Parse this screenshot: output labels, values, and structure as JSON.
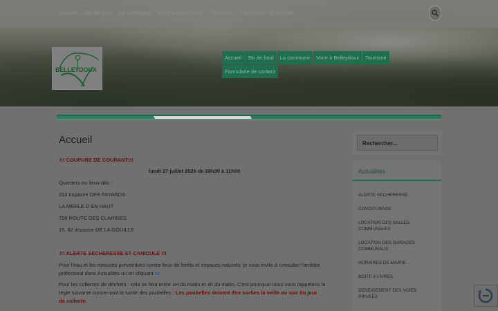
{
  "topbar": {
    "items": [
      "Accueil",
      "Ski de fond",
      "La commune",
      "Vivre à Belleydoux",
      "Tourisme",
      "Formulaire de contact"
    ]
  },
  "logo": {
    "text": "BELLEYDOUX"
  },
  "mainnav": {
    "row1": [
      "Accueil",
      "Ski de fond",
      "La commune",
      "Vivre à Belleydoux",
      "Tourisme"
    ],
    "row2": [
      "Formulaire de contact"
    ]
  },
  "content": {
    "title": "Accueil",
    "alert1": "!!! COUPURE DE COURANT!!!",
    "date_line": "lundi 27 juillet 2026 de 08h30 à 11h00",
    "quartiers": "Quartiers ou lieux-dits :",
    "addresses": [
      "316 impasse DES FAYARDS",
      "LA MERLE D EN HAUT",
      "798 ROUTE DES CLARINES",
      "15, 82 impasse DE LA GOUILLE"
    ],
    "alert2": "!!! ALERTE SECHERESSE ET CANICULE !!!",
    "para1_a": "Pour l'eau et les mesures préventives contre feux de forêts et espaces naturels: je vous invite à consulter l'arrêtée",
    "para1_b": "préfectoral dans Actualités ou en cliquant",
    "para1_link": "ici",
    "para1_end": ".",
    "para2_a": "Pour les collectes de déchets : cela se fera entre 1H du matin et 4h du matin. C'est pourquoi nous vous rappelons la",
    "para2_b": "règle suivante concernant la sortie des poubelles : ",
    "para2_red1": "Les poubelles doivent être sorties la veille au soir du jour",
    "para2_red2": "de collecte",
    "para2_end": "."
  },
  "sidebar": {
    "search_placeholder": "Rechercher...",
    "title": "Actualités",
    "items": [
      [
        "ALERTE SECHERESSE"
      ],
      [
        "COVOITURAGE"
      ],
      [
        "LOCATION DES SALLES",
        "COMMUNALES"
      ],
      [
        "LOCATION DES GARAGES",
        "COMMUNAUX"
      ],
      [
        "HORAIRES DE MAIRIE"
      ],
      [
        "BOITE A LIVRES"
      ],
      [
        "DENEIGEMENT DES VOIES",
        "PRIVEES"
      ]
    ]
  },
  "colors": {
    "accent_green": "#1f6f4e",
    "alert_red": "#6b0c0c"
  },
  "icons": [
    "search-icon",
    "recaptcha-icon"
  ]
}
